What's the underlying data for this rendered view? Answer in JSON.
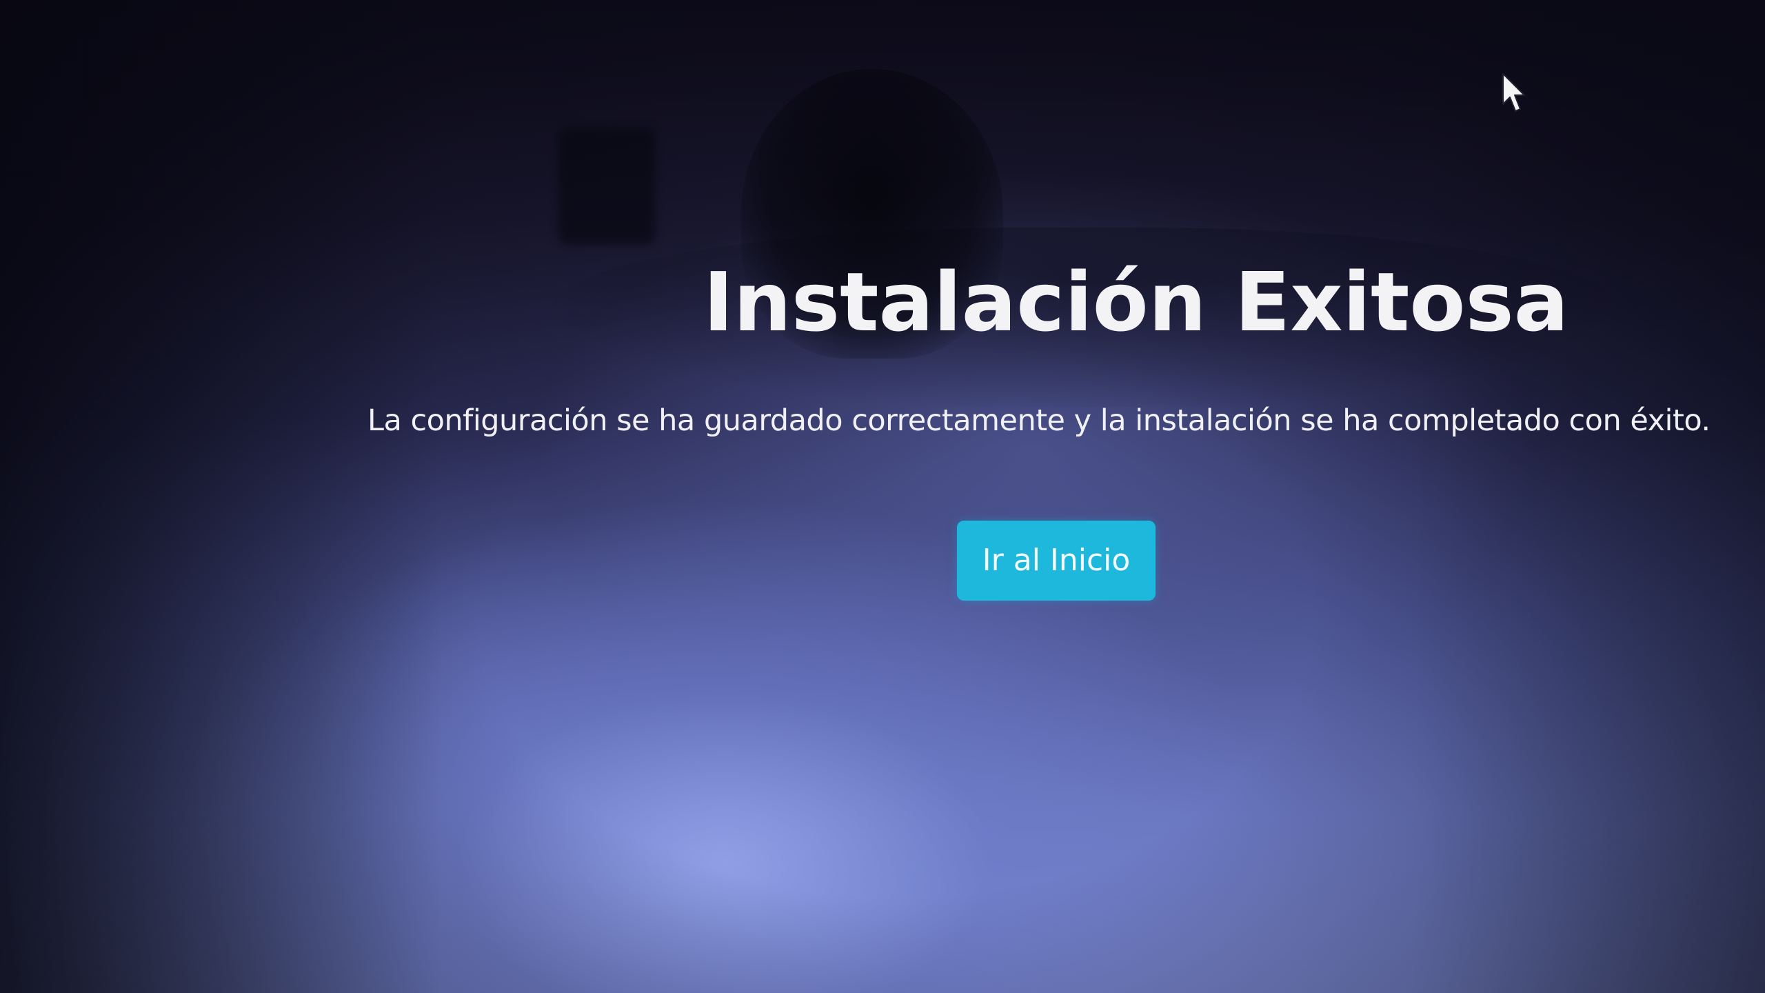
{
  "page": {
    "title": "Instalación Exitosa",
    "message": "La configuración se ha guardado correctamente y la instalación se ha completado con éxito.",
    "button_label": "Ir al Inicio"
  },
  "colors": {
    "button_background": "#1db8dc",
    "button_text": "#f4fbff",
    "text": "#f3f3f6",
    "background_top": "#120f1f",
    "background_bottom": "#7b89d0"
  },
  "icons": {
    "cursor": "mouse-pointer-icon"
  }
}
